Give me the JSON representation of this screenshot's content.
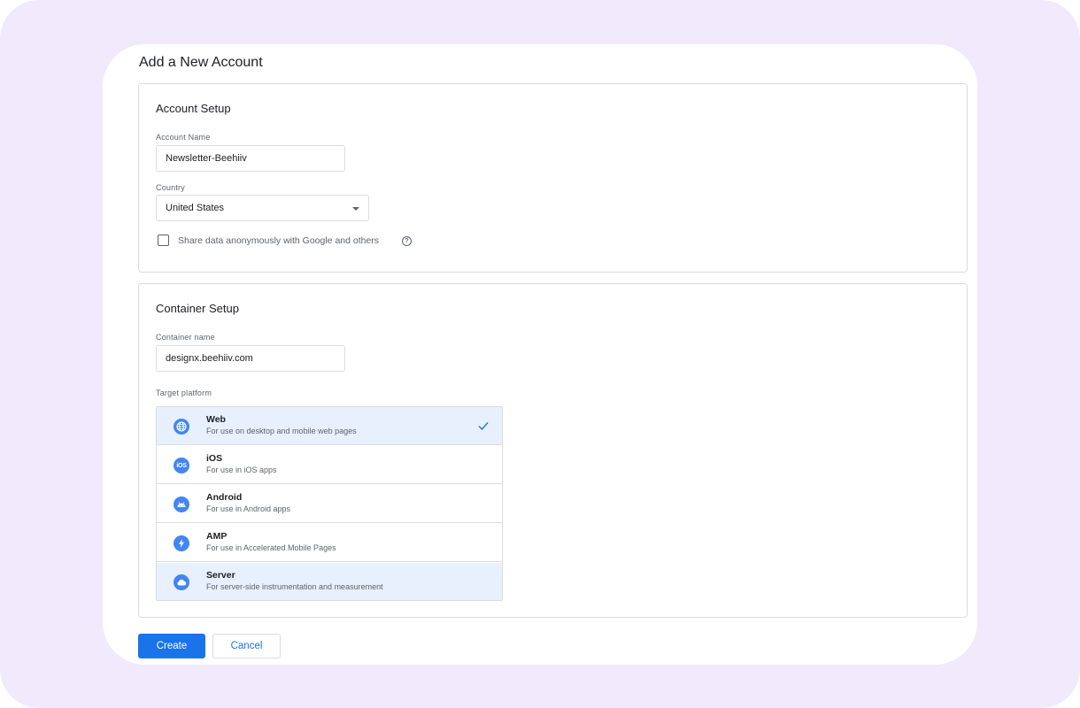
{
  "dialog": {
    "title": "Add a New Account"
  },
  "account_setup": {
    "title": "Account Setup",
    "account_name_label": "Account Name",
    "account_name_value": "Newsletter-Beehiiv",
    "country_label": "Country",
    "country_value": "United States",
    "share_data_label": "Share data anonymously with Google and others",
    "share_data_checked": false,
    "help_icon": "help-circle-icon"
  },
  "container_setup": {
    "title": "Container Setup",
    "container_name_label": "Container name",
    "container_name_value": "designx.beehiiv.com",
    "target_platform_label": "Target platform",
    "platforms": [
      {
        "name": "Web",
        "description": "For use on desktop and mobile web pages",
        "icon": "globe-icon",
        "selected": true
      },
      {
        "name": "iOS",
        "description": "For use in iOS apps",
        "icon": "ios-icon",
        "icon_text": "iOS",
        "selected": false
      },
      {
        "name": "Android",
        "description": "For use in Android apps",
        "icon": "android-icon",
        "selected": false
      },
      {
        "name": "AMP",
        "description": "For use in Accelerated Mobile Pages",
        "icon": "lightning-icon",
        "selected": false
      },
      {
        "name": "Server",
        "description": "For server-side instrumentation and measurement",
        "icon": "cloud-icon",
        "selected": false
      }
    ]
  },
  "actions": {
    "create_label": "Create",
    "cancel_label": "Cancel"
  },
  "colors": {
    "accent": "#1a73e8",
    "icon_blue": "#4285f4",
    "selected_bg": "#e8f0fe",
    "backdrop": "#f1eafc"
  }
}
